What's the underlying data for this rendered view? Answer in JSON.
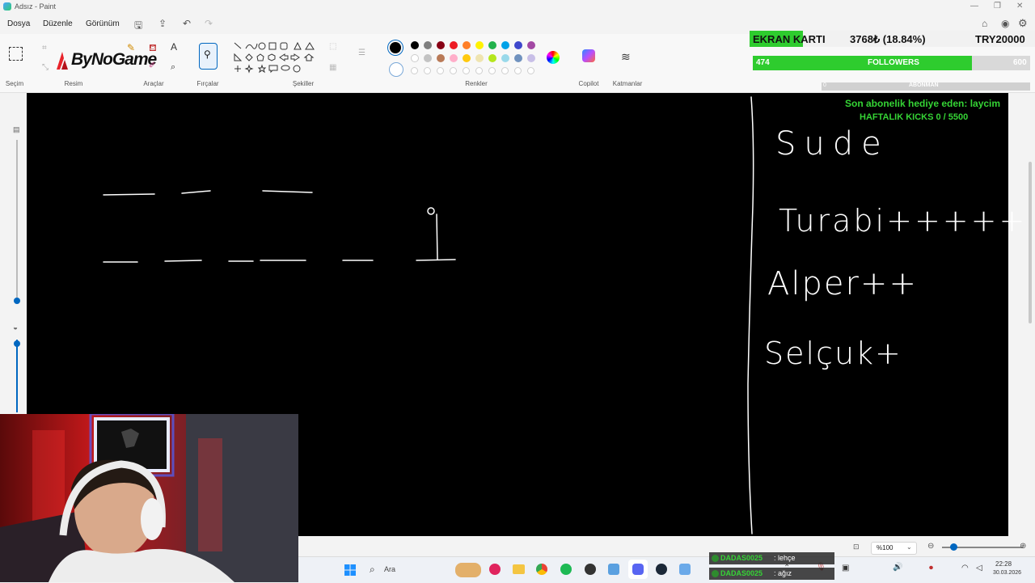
{
  "window": {
    "title": "Adsız - Paint"
  },
  "menu": {
    "file": "Dosya",
    "edit": "Düzenle",
    "view": "Görünüm"
  },
  "ribbon": {
    "groups": {
      "selection": "Seçim",
      "image": "Resim",
      "tools": "Araçlar",
      "brushes": "Fırçalar",
      "shapes": "Şekiller",
      "colors": "Renkler",
      "copilot": "Copilot",
      "layers": "Katmanlar"
    },
    "logo_text": "ByNoGame",
    "palette_row1": [
      "#000000",
      "#7f7f7f",
      "#880015",
      "#ed1c24",
      "#ff7f27",
      "#fff200",
      "#22b14c",
      "#00a2e8",
      "#3f48cc",
      "#a349a4"
    ],
    "palette_row2": [
      "#ffffff",
      "#c3c3c3",
      "#b97a57",
      "#ffaec9",
      "#ffc90e",
      "#efe4b0",
      "#b5e61d",
      "#99d9ea",
      "#7092be",
      "#c8bfe7"
    ]
  },
  "stream_overlay": {
    "gpu_label": "EKRAN KARTI",
    "gpu_value": "3768₺ (18.84%)",
    "gpu_goal": "TRY20000",
    "followers_current": "474",
    "followers_label": "FOLLOWERS",
    "followers_goal": "600",
    "followers_progress": 0.79,
    "sub_left": "0",
    "sub_label": "ABONMAN",
    "gift_text": "Son abonelik hediye eden: laycim",
    "kicks_text": "HAFTALIK KICKS 0 / 5500"
  },
  "canvas_text": {
    "line1": "Sude",
    "line2": "Turabi+++++",
    "line3": "Alper++",
    "line4": "Selçuk+"
  },
  "chat": [
    {
      "user": "DADAS0025",
      "message": ": lehçe"
    },
    {
      "user": "DADAS0025",
      "message": ": ağız"
    }
  ],
  "statusbar": {
    "zoom": "%100"
  },
  "taskbar": {
    "search_placeholder": "Ara",
    "time": "22:28",
    "date": "30.03.2026"
  },
  "colors": {
    "accent": "#0067c0",
    "overlay_green": "#2ecc2e",
    "kicks_green": "#35d435"
  }
}
